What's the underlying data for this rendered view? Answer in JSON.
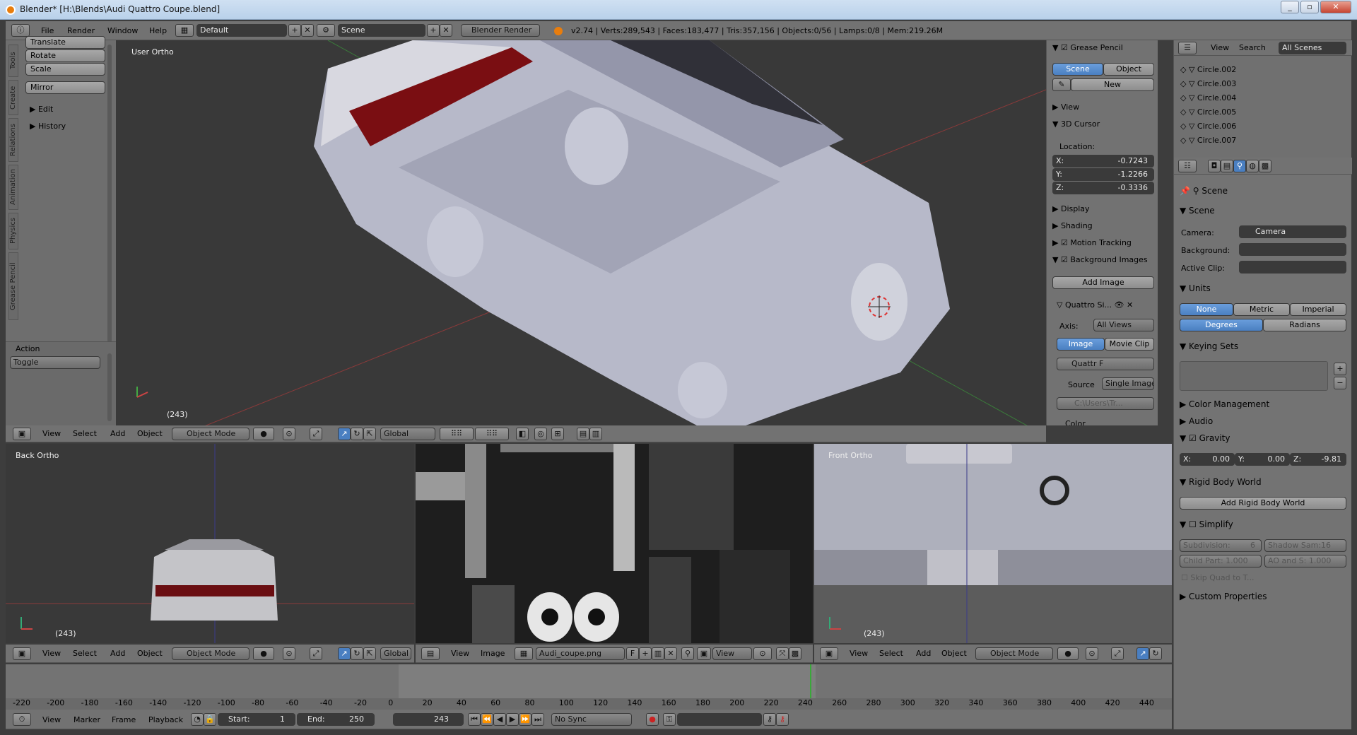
{
  "window": {
    "title": "Blender* [H:\\Blends\\Audi Quattro Coupe.blend]"
  },
  "info_header": {
    "menus": [
      "File",
      "Render",
      "Window",
      "Help"
    ],
    "layout": "Default",
    "scene": "Scene",
    "engine": "Blender Render",
    "stats": "v2.74 | Verts:289,543 | Faces:183,477 | Tris:357,156 | Objects:0/56 | Lamps:0/8 | Mem:219.26M"
  },
  "tool_shelf": {
    "tabs": [
      "Tools",
      "Create",
      "Relations",
      "Animation",
      "Physics",
      "Grease Pencil"
    ],
    "buttons": [
      "Translate",
      "Rotate",
      "Scale",
      "Mirror"
    ],
    "sections": [
      "Edit",
      "History"
    ],
    "operator_title": "Action",
    "operator_value": "Toggle"
  },
  "viewport_main": {
    "label": "User Ortho",
    "frame": "(243)"
  },
  "view_header": {
    "menus": [
      "View",
      "Select",
      "Add",
      "Object"
    ],
    "mode": "Object Mode",
    "orientation": "Global"
  },
  "properties_n": {
    "grease_pencil": "Grease Pencil",
    "gp_scene": "Scene",
    "gp_object": "Object",
    "gp_new": "New",
    "view": "View",
    "cursor": "3D Cursor",
    "location": "Location:",
    "x": "X:",
    "xv": "-0.7243",
    "y": "Y:",
    "yv": "-1.2266",
    "z": "Z:",
    "zv": "-0.3336",
    "display": "Display",
    "shading": "Shading",
    "motion": "Motion Tracking",
    "bg_images": "Background Images",
    "add_image": "Add Image",
    "bg_item": "Quattro Si...",
    "axis": "Axis:",
    "axis_value": "All Views",
    "image_tab": "Image",
    "movie_tab": "Movie Clip",
    "img_name": "Quattr",
    "img_f": "F",
    "source": "Source",
    "source_value": "Single Image",
    "path": "C:\\Users\\Tr...",
    "color": "Color"
  },
  "outliner": {
    "menus": [
      "View",
      "Search"
    ],
    "display_mode": "All Scenes",
    "items": [
      "Circle.002",
      "Circle.003",
      "Circle.004",
      "Circle.005",
      "Circle.006",
      "Circle.007"
    ]
  },
  "scene_props": {
    "breadcrumb": "Scene",
    "scene_section": "Scene",
    "camera_label": "Camera:",
    "camera_value": "Camera",
    "background_label": "Background:",
    "active_clip_label": "Active Clip:",
    "units": "Units",
    "none": "None",
    "metric": "Metric",
    "imperial": "Imperial",
    "degrees": "Degrees",
    "radians": "Radians",
    "keying_sets": "Keying Sets",
    "color_management": "Color Management",
    "audio": "Audio",
    "gravity": "Gravity",
    "gx": "X:",
    "gxv": "0.00",
    "gy": "Y:",
    "gyv": "0.00",
    "gz": "Z:",
    "gzv": "-9.81",
    "rigid_body": "Rigid Body World",
    "add_rigid": "Add Rigid Body World",
    "simplify": "Simplify",
    "subdivision": "Subdivision:",
    "subdivision_v": "6",
    "shadow": "Shadow Sam:16",
    "child": "Child Part: 1.000",
    "ao": "AO and S: 1.000",
    "skip_quad": "Skip Quad to T...",
    "custom": "Custom Properties"
  },
  "viewport_back": {
    "label": "Back Ortho",
    "frame": "(243)"
  },
  "viewport_front": {
    "label": "Front Ortho",
    "frame": "(243)"
  },
  "image_editor": {
    "menus": [
      "View",
      "Image"
    ],
    "image_name": "Audi_coupe.png",
    "f": "F",
    "view": "View"
  },
  "timeline": {
    "ticks": [
      "-220",
      "-200",
      "-180",
      "-160",
      "-140",
      "-120",
      "-100",
      "-80",
      "-60",
      "-40",
      "-20",
      "0",
      "20",
      "40",
      "60",
      "80",
      "100",
      "120",
      "140",
      "160",
      "180",
      "200",
      "220",
      "240",
      "260",
      "280",
      "300",
      "320",
      "340",
      "360",
      "380",
      "400",
      "420",
      "440"
    ],
    "menus": [
      "View",
      "Marker",
      "Frame",
      "Playback"
    ],
    "start_label": "Start:",
    "start": "1",
    "end_label": "End:",
    "end": "250",
    "current": "243",
    "sync": "No Sync"
  }
}
